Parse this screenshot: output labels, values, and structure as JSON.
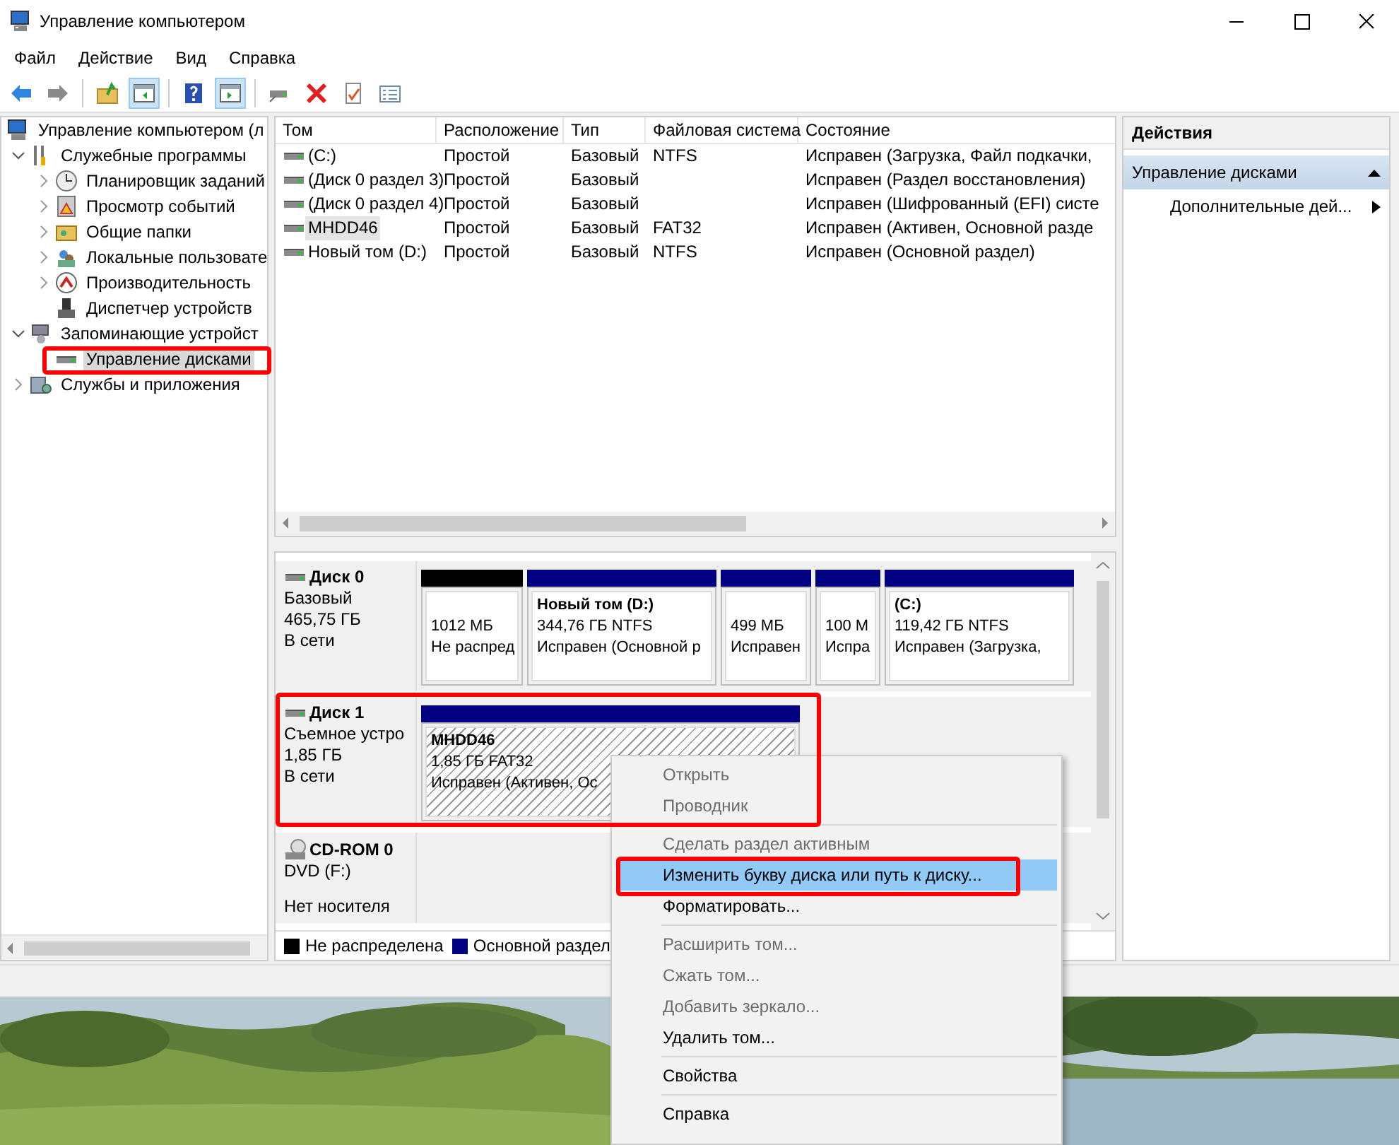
{
  "window": {
    "title": "Управление компьютером"
  },
  "menu": [
    "Файл",
    "Действие",
    "Вид",
    "Справка"
  ],
  "tree": [
    {
      "label": "Управление компьютером (л",
      "selected": false,
      "children": [
        {
          "label": "Служебные программы",
          "expanded": true,
          "selected": false,
          "children": [
            {
              "label": "Планировщик заданий",
              "expanded": false,
              "selected": false
            },
            {
              "label": "Просмотр событий",
              "expanded": false,
              "selected": false
            },
            {
              "label": "Общие папки",
              "expanded": false,
              "selected": false
            },
            {
              "label": "Локальные пользовате",
              "expanded": false,
              "selected": false
            },
            {
              "label": "Производительность",
              "expanded": false,
              "selected": false
            },
            {
              "label": "Диспетчер устройств",
              "selected": false
            }
          ]
        },
        {
          "label": "Запоминающие устройст",
          "expanded": true,
          "selected": false,
          "children": [
            {
              "label": "Управление дисками",
              "selected": true
            }
          ]
        },
        {
          "label": "Службы и приложения",
          "expanded": false,
          "selected": false
        }
      ]
    }
  ],
  "volumes": {
    "columns": [
      "Том",
      "Расположение",
      "Тип",
      "Файловая система",
      "Состояние"
    ],
    "rows": [
      {
        "cells": [
          "(C:)",
          "Простой",
          "Базовый",
          "NTFS",
          "Исправен (Загрузка, Файл подкачки,"
        ],
        "selected": false
      },
      {
        "cells": [
          "(Диск 0 раздел 3)",
          "Простой",
          "Базовый",
          "",
          "Исправен (Раздел восстановления)"
        ],
        "selected": false
      },
      {
        "cells": [
          "(Диск 0 раздел 4)",
          "Простой",
          "Базовый",
          "",
          "Исправен (Шифрованный (EFI) систе"
        ],
        "selected": false
      },
      {
        "cells": [
          "MHDD46",
          "Простой",
          "Базовый",
          "FAT32",
          "Исправен (Активен, Основной разде"
        ],
        "selected": true
      },
      {
        "cells": [
          "Новый том (D:)",
          "Простой",
          "Базовый",
          "NTFS",
          "Исправен (Основной раздел)"
        ],
        "selected": false
      }
    ]
  },
  "disks": [
    {
      "kind": "disk",
      "name": "Диск 0",
      "details": [
        "Базовый",
        "465,75 ГБ"
      ],
      "status": "В сети",
      "partitions": [
        {
          "color": "#000000",
          "lines": [
            "1012 МБ",
            "Не распред"
          ],
          "selected": false
        },
        {
          "color": "#000080",
          "title": "Новый том  (D:)",
          "lines": [
            "344,76 ГБ NTFS",
            "Исправен (Основной р"
          ],
          "selected": false
        },
        {
          "color": "#000080",
          "lines": [
            "499 МБ",
            "Исправен"
          ],
          "selected": false
        },
        {
          "color": "#000080",
          "lines": [
            "100 М",
            "Испра"
          ],
          "selected": false
        },
        {
          "color": "#000080",
          "title": "(C:)",
          "lines": [
            "119,42 ГБ NTFS",
            "Исправен (Загрузка,"
          ],
          "selected": false
        }
      ]
    },
    {
      "kind": "disk",
      "name": "Диск 1",
      "details": [
        "Съемное устро",
        "1,85 ГБ"
      ],
      "status": "В сети",
      "partitions": [
        {
          "color": "#000080",
          "title": "MHDD46",
          "lines": [
            "1,85 ГБ FAT32",
            "Исправен (Активен, Ос"
          ],
          "selected": true
        }
      ]
    },
    {
      "kind": "cdrom",
      "name": "CD-ROM 0",
      "details": [
        "DVD (F:)"
      ],
      "status": "Нет носителя"
    }
  ],
  "legend": [
    {
      "label": "Не распределена",
      "color": "#000000"
    },
    {
      "label": "Основной раздел",
      "color": "#000080"
    }
  ],
  "actions": {
    "title": "Действия",
    "sections": [
      {
        "label": "Управление дисками",
        "expanded": true,
        "items": [
          {
            "label": "Дополнительные дей...",
            "submenu": true
          }
        ]
      }
    ]
  },
  "context_menu": {
    "items": [
      {
        "kind": "item",
        "label": "Открыть",
        "disabled": true,
        "selected": false
      },
      {
        "kind": "item",
        "label": "Проводник",
        "disabled": true,
        "selected": false
      },
      {
        "kind": "separator"
      },
      {
        "kind": "item",
        "label": "Сделать раздел активным",
        "disabled": true,
        "selected": false
      },
      {
        "kind": "item",
        "label": "Изменить букву диска или путь к диску...",
        "disabled": false,
        "selected": true
      },
      {
        "kind": "item",
        "label": "Форматировать...",
        "disabled": false,
        "selected": false
      },
      {
        "kind": "separator"
      },
      {
        "kind": "item",
        "label": "Расширить том...",
        "disabled": true,
        "selected": false
      },
      {
        "kind": "item",
        "label": "Сжать том...",
        "disabled": true,
        "selected": false
      },
      {
        "kind": "item",
        "label": "Добавить зеркало...",
        "disabled": true,
        "selected": false
      },
      {
        "kind": "item",
        "label": "Удалить том...",
        "disabled": false,
        "selected": false
      },
      {
        "kind": "separator"
      },
      {
        "kind": "item",
        "label": "Свойства",
        "disabled": false,
        "selected": false
      },
      {
        "kind": "separator"
      },
      {
        "kind": "item",
        "label": "Справка",
        "disabled": false,
        "selected": false
      }
    ]
  }
}
